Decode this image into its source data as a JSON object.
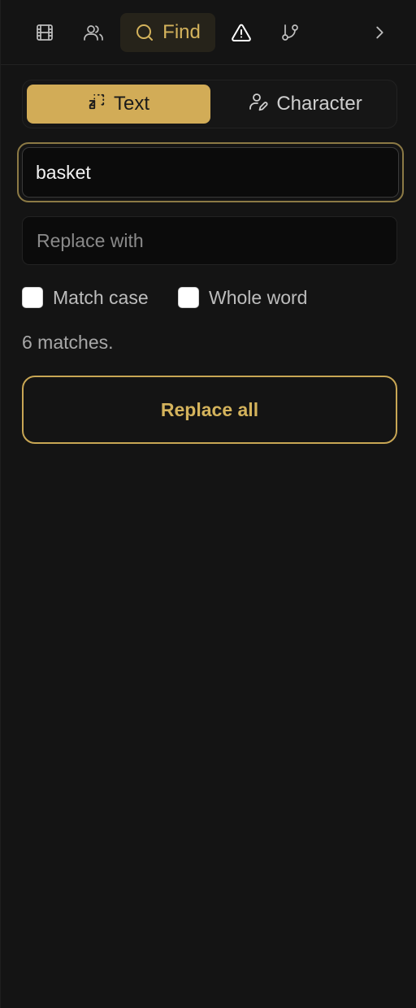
{
  "toolbar": {
    "find_label": "Find",
    "icons": [
      "film-icon",
      "users-icon",
      "search-icon",
      "warning-icon",
      "branch-icon",
      "chevron-right-icon"
    ]
  },
  "segment": {
    "text_label": "Text",
    "character_label": "Character"
  },
  "find": {
    "value": "basket"
  },
  "replace": {
    "placeholder": "Replace with",
    "value": ""
  },
  "options": {
    "match_case_label": "Match case",
    "match_case_checked": false,
    "whole_word_label": "Whole word",
    "whole_word_checked": false
  },
  "status": {
    "match_count_text": "6 matches."
  },
  "actions": {
    "replace_all_label": "Replace all"
  },
  "colors": {
    "background": "#141414",
    "accent": "#d2ac57",
    "accent_text": "#d4b35c",
    "input_background": "#0b0b0b"
  }
}
